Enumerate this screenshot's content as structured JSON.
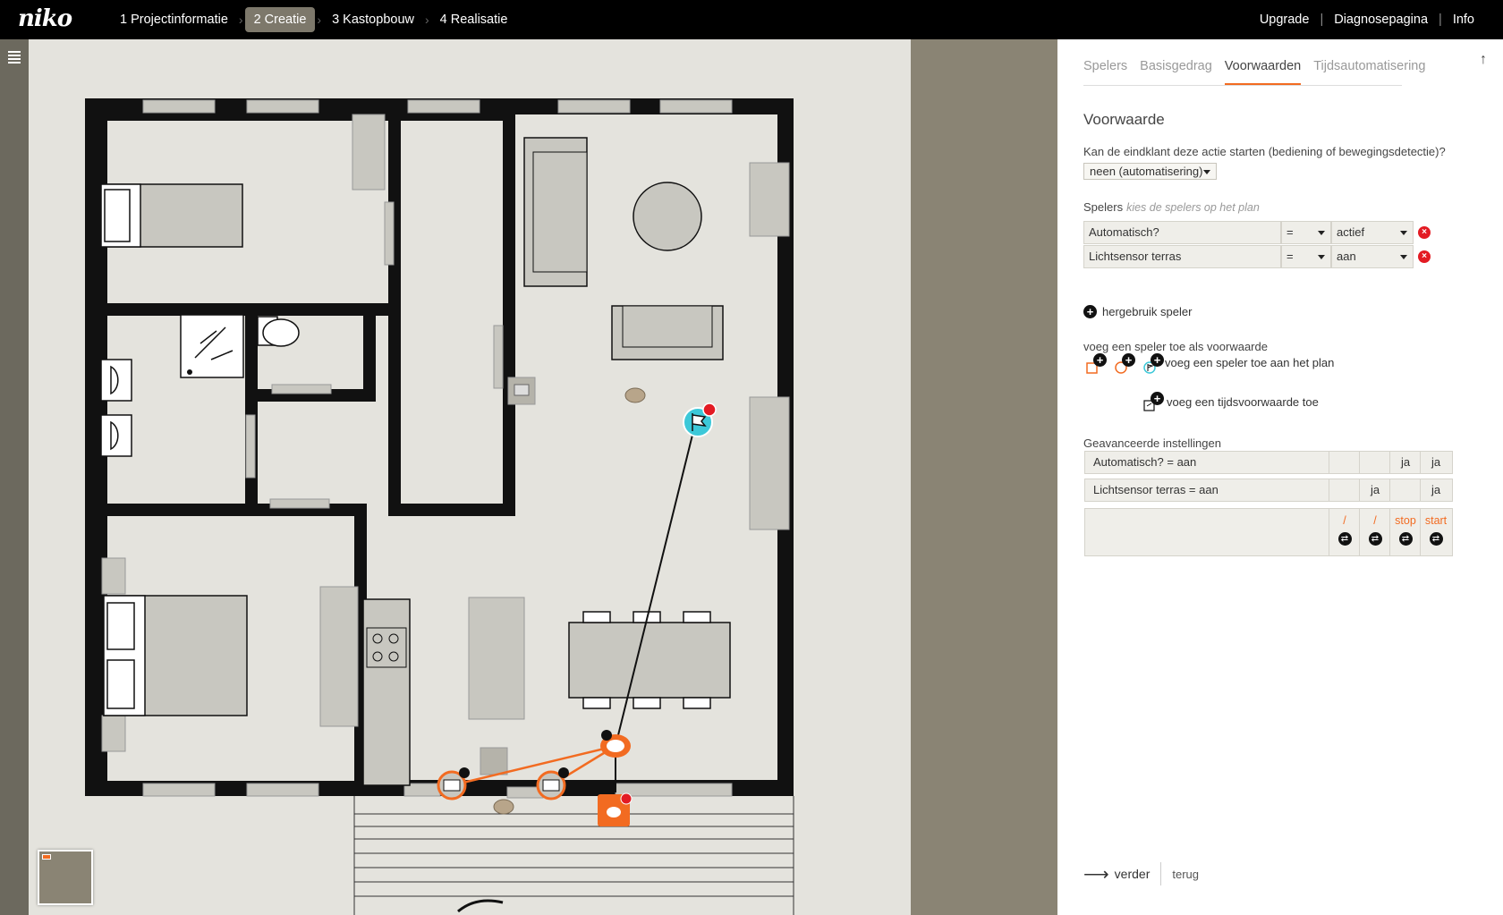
{
  "brand": "niko",
  "steps": [
    {
      "label": "1 Projectinformatie"
    },
    {
      "label": "2 Creatie"
    },
    {
      "label": "3 Kastopbouw"
    },
    {
      "label": "4 Realisatie"
    }
  ],
  "toplinks": {
    "upgrade": "Upgrade",
    "diagnose": "Diagnosepagina",
    "info": "Info",
    "sep": "|"
  },
  "tabs": [
    "Spelers",
    "Basisgedrag",
    "Voorwaarden",
    "Tijdsautomatisering"
  ],
  "active_tab": "Voorwaarden",
  "panel": {
    "title": "Voorwaarde",
    "question": "Kan de eindklant deze actie starten (bediening of bewegingsdetectie)?",
    "question_value": "neen (automatisering)",
    "spelers_label": "Spelers",
    "spelers_hint": "kies de spelers op het plan",
    "conditions": [
      {
        "name": "Automatisch?",
        "op": "=",
        "value": "actief"
      },
      {
        "name": "Lichtsensor terras",
        "op": "=",
        "value": "aan"
      }
    ],
    "reuse_label": "hergebruik speler",
    "add_label": "voeg een speler toe als voorwaarde",
    "add_plan_label": "voeg een speler toe aan het plan",
    "add_time_label": "voeg een tijdsvoorwaarde toe",
    "advanced_label": "Geavanceerde instellingen",
    "advanced_rows": [
      {
        "name": "Automatisch? = aan",
        "c1": "",
        "c2": "",
        "c3": "ja",
        "c4": "ja"
      },
      {
        "name": "Lichtsensor terras = aan",
        "c1": "",
        "c2": "ja",
        "c3": "",
        "c4": "ja"
      }
    ],
    "advanced_footer": [
      "/",
      "/",
      "stop",
      "start"
    ],
    "next_label": "verder",
    "back_label": "terug"
  },
  "colors": {
    "accent": "#f26b21",
    "cyan": "#3cc8d8",
    "remove": "#e31b23",
    "wall": "#111111",
    "furniture": "#c8c7c0"
  }
}
